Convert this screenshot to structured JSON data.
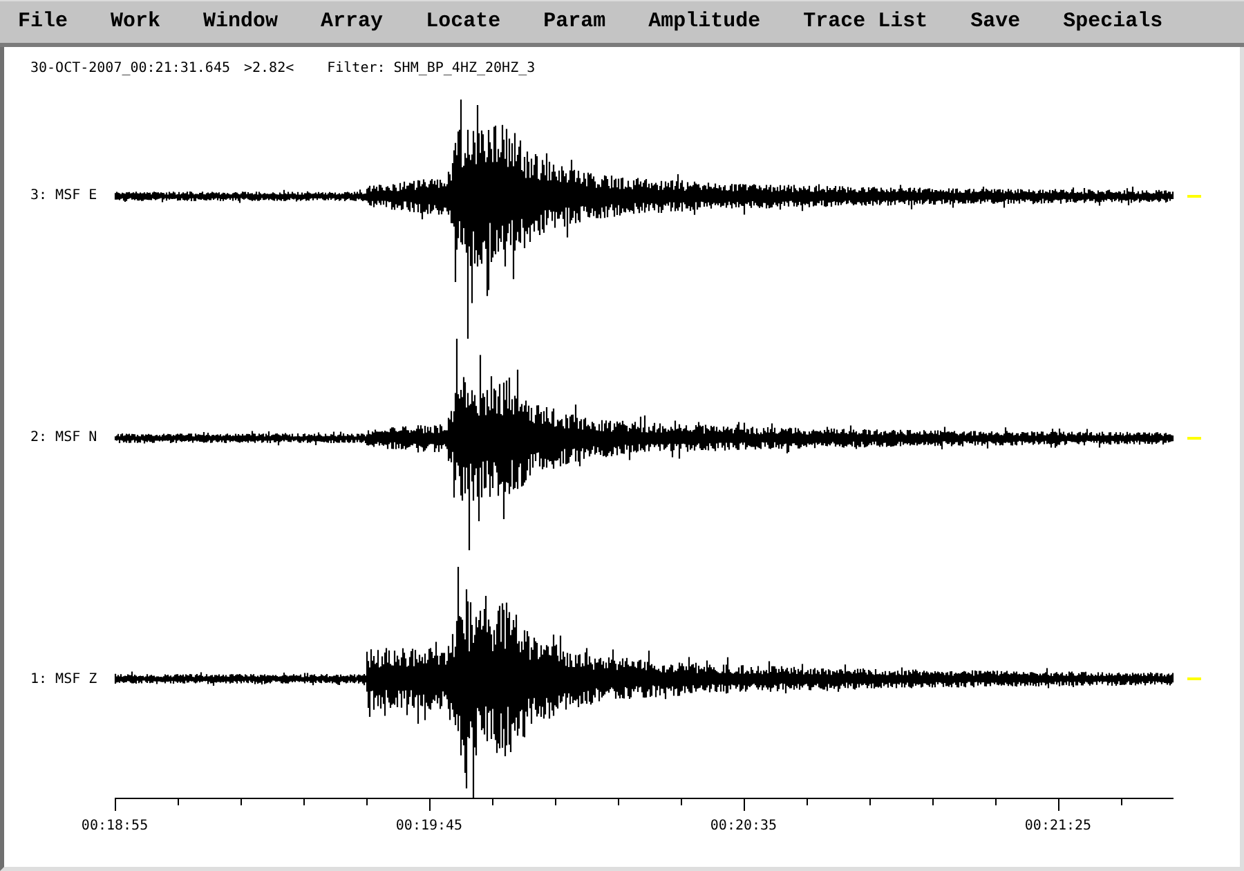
{
  "menu": [
    "File",
    "Work",
    "Window",
    "Array",
    "Locate",
    "Param",
    "Amplitude",
    "Trace List",
    "Save",
    "Specials"
  ],
  "header": {
    "timestamp": "30-OCT-2007_00:21:31.645",
    "scale": ">2.82<",
    "filter": "Filter: SHM_BP_4HZ_20HZ_3"
  },
  "traces": [
    {
      "label": "3: MSF E"
    },
    {
      "label": "2: MSF N"
    },
    {
      "label": "1: MSF Z"
    }
  ],
  "time_axis": {
    "labels": [
      "00:18:55",
      "00:19:45",
      "00:20:35",
      "00:21:25"
    ]
  }
}
